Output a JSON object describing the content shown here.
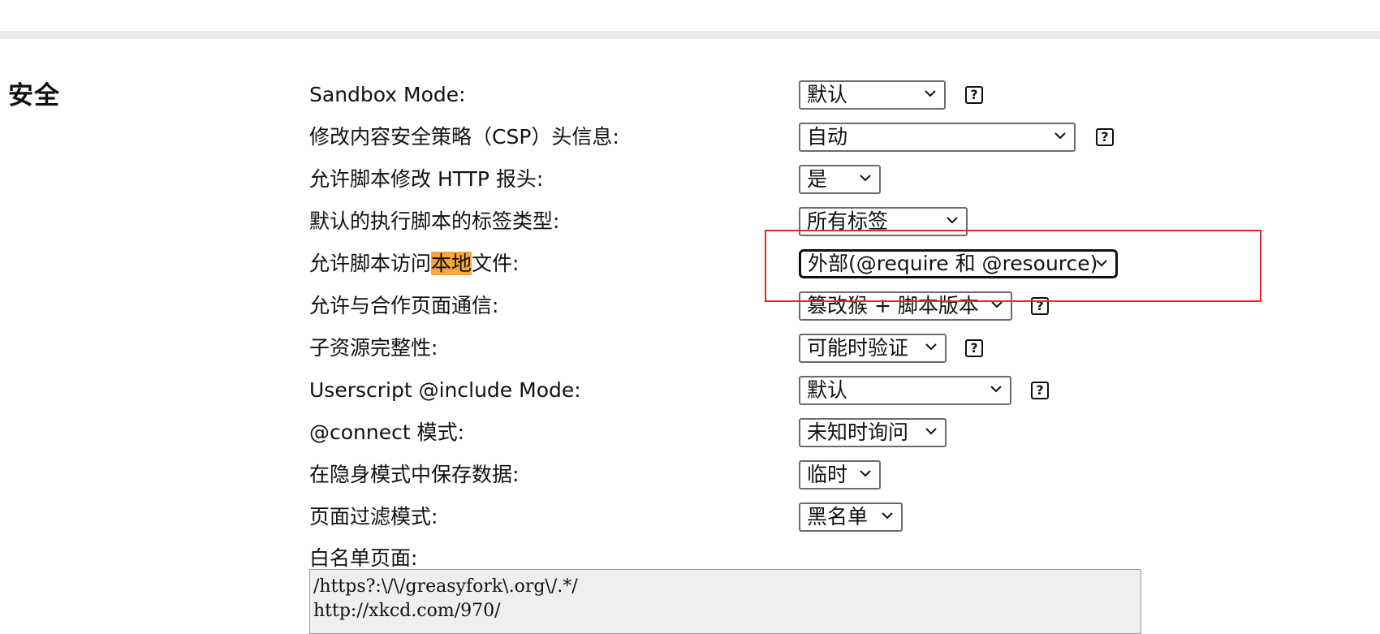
{
  "section": {
    "title": "安全"
  },
  "rows": [
    {
      "label": "Sandbox Mode:",
      "value": "默认",
      "has_help": true
    },
    {
      "label": "修改内容安全策略（CSP）头信息:",
      "value": "自动",
      "has_help": true
    },
    {
      "label": "允许脚本修改 HTTP 报头:",
      "value": "是",
      "has_help": false
    },
    {
      "label": "默认的执行脚本的标签类型:",
      "value": "所有标签",
      "has_help": false
    },
    {
      "label_prefix": "允许脚本访问",
      "label_highlight": "本地",
      "label_suffix": "文件:",
      "value": "外部(@require 和 @resource)",
      "has_help": false,
      "focused": true
    },
    {
      "label": "允许与合作页面通信:",
      "value": "篡改猴 + 脚本版本",
      "has_help": true
    },
    {
      "label": "子资源完整性:",
      "value": "可能时验证",
      "has_help": true
    },
    {
      "label": "Userscript @include Mode:",
      "value": "默认",
      "has_help": true
    },
    {
      "label": "@connect 模式:",
      "value": "未知时询问",
      "has_help": false
    },
    {
      "label": "在隐身模式中保存数据:",
      "value": "临时",
      "has_help": false
    },
    {
      "label": "页面过滤模式:",
      "value": "黑名单",
      "has_help": false
    }
  ],
  "help_icon": {
    "glyph": "?",
    "name": "help-icon"
  },
  "whitelist": {
    "label": "白名单页面:",
    "value": "/https?:\\/\\/greasyfork\\.org\\/.*/\nhttp://xkcd.com/970/"
  },
  "colors": {
    "highlight": "#f6a63a",
    "annotation": "#e0282e",
    "divider": "#ececec"
  }
}
